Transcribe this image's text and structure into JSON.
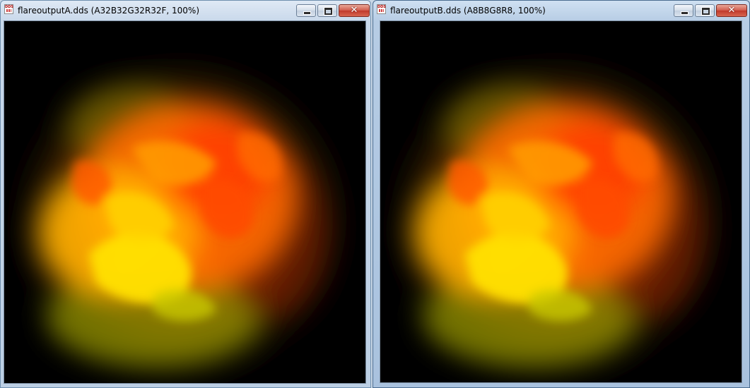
{
  "windows": [
    {
      "title": "flareoutputA.dds (A32B32G32R32F, 100%)",
      "icon": "dds-file-icon",
      "active": false,
      "controls": {
        "minimize": "minimize-icon",
        "maximize": "maximize-icon",
        "close": "✕"
      }
    },
    {
      "title": "flareoutputB.dds (A8B8G8R8, 100%)",
      "icon": "dds-file-icon",
      "active": true,
      "controls": {
        "minimize": "minimize-icon",
        "maximize": "maximize-icon",
        "close": "✕"
      }
    }
  ],
  "app_icon_text": "DDS",
  "colors": {
    "flare_core": "#ffe000",
    "flare_mid": "#ff7a00",
    "flare_deep": "#e83400",
    "flare_edge": "#6a5a00",
    "background": "#000000"
  }
}
